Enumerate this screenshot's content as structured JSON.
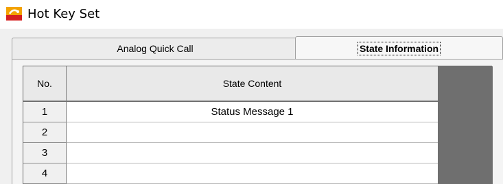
{
  "window": {
    "title": "Hot Key Set",
    "icon": "app-logo-icon"
  },
  "tabs": [
    {
      "label": "Analog Quick Call",
      "active": false
    },
    {
      "label": "State Information",
      "active": true
    }
  ],
  "table": {
    "columns": [
      "No.",
      "State Content"
    ],
    "rows": [
      {
        "no": "1",
        "content": "Status Message 1"
      },
      {
        "no": "2",
        "content": ""
      },
      {
        "no": "3",
        "content": ""
      },
      {
        "no": "4",
        "content": ""
      }
    ]
  },
  "colors": {
    "accent_icon": "#e8a000",
    "grey_area": "#6f6f6f"
  }
}
